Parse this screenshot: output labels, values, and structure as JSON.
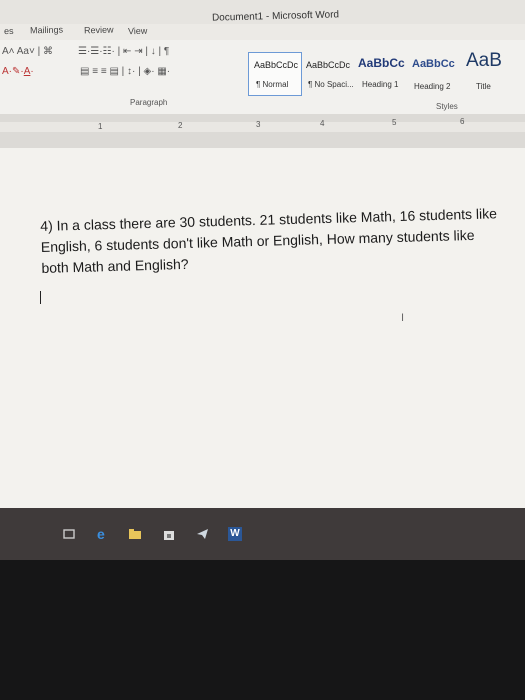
{
  "window": {
    "title": "Document1 - Microsoft Word"
  },
  "ribbon_tabs": [
    "es",
    "Mailings",
    "Review",
    "View"
  ],
  "ribbon": {
    "font_size_label": "Aa",
    "paragraph_group": "Paragraph",
    "styles_group": "Styles",
    "styles": [
      {
        "sample": "AaBbCcDc",
        "label": "¶ Normal"
      },
      {
        "sample": "AaBbCcDc",
        "label": "¶ No Spaci..."
      },
      {
        "sample": "AaBbCc",
        "label": "Heading 1"
      },
      {
        "sample": "AaBbCc",
        "label": "Heading 2"
      },
      {
        "sample": "AaB",
        "label": "Title"
      }
    ]
  },
  "ruler": {
    "numbers": [
      "1",
      "2",
      "3",
      "4",
      "5",
      "6"
    ]
  },
  "document": {
    "question": "4) In a class there are 30 students. 21 students like Math, 16 students like English, 6 students don't like Math or English, How many students like both Math and English?"
  },
  "taskbar": {
    "icons": [
      "task-view-icon",
      "edge-icon",
      "file-explorer-icon",
      "store-icon",
      "mail-icon",
      "word-icon"
    ],
    "word_label": "W"
  }
}
